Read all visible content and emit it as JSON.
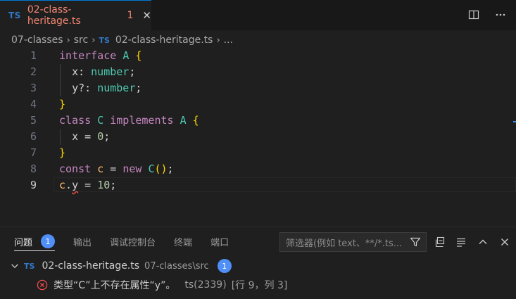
{
  "tab": {
    "badge": "TS",
    "filename": "02-class-heritage.ts",
    "problem_count": "1",
    "close_glyph": "✕",
    "active_color": "#f48771"
  },
  "breadcrumb": {
    "items": [
      "07-classes",
      "src",
      "02-class-heritage.ts",
      "..."
    ],
    "file_badge": "TS"
  },
  "editor": {
    "active_line": 9,
    "lines": [
      {
        "n": "1"
      },
      {
        "n": "2"
      },
      {
        "n": "3"
      },
      {
        "n": "4"
      },
      {
        "n": "5"
      },
      {
        "n": "6"
      },
      {
        "n": "7"
      },
      {
        "n": "8"
      },
      {
        "n": "9"
      }
    ],
    "tokens": {
      "l1": [
        "interface",
        "A",
        "{"
      ],
      "l2": [
        "x",
        ":",
        "number",
        ";"
      ],
      "l3": [
        "y",
        "?:",
        "number",
        ";"
      ],
      "l4": [
        "}"
      ],
      "l5": [
        "class",
        "C",
        "implements",
        "A",
        "{"
      ],
      "l6": [
        "x",
        "=",
        "0",
        ";"
      ],
      "l7": [
        "}"
      ],
      "l8": [
        "const",
        "c",
        "=",
        "new",
        "C",
        "(",
        ")",
        ";"
      ],
      "l9": [
        "c",
        ".",
        "y",
        "=",
        "10",
        ";"
      ]
    }
  },
  "panel": {
    "tabs": [
      {
        "label": "问题",
        "badge": "1",
        "active": true
      },
      {
        "label": "输出"
      },
      {
        "label": "调试控制台"
      },
      {
        "label": "终端"
      },
      {
        "label": "端口"
      }
    ],
    "filter_placeholder": "筛选器(例如 text、**/*.ts...",
    "file": {
      "badge": "TS",
      "name": "02-class-heritage.ts",
      "path": "07-classes\\src",
      "count": "1"
    },
    "problem": {
      "message": "类型“C”上不存在属性“y”。",
      "source": "ts(2339)",
      "location": "[行 9，列 3]"
    }
  },
  "colors": {
    "accent": "#0078d4",
    "badge": "#4f8ff7",
    "error": "#f14c4c",
    "ts_blue": "#3178c6"
  },
  "icons": [
    "split-editor-icon",
    "more-actions-icon",
    "filter-icon",
    "collapse-all-icon",
    "view-as-list-icon",
    "maximize-panel-icon",
    "close-panel-icon",
    "chevron-down-icon",
    "error-icon"
  ]
}
